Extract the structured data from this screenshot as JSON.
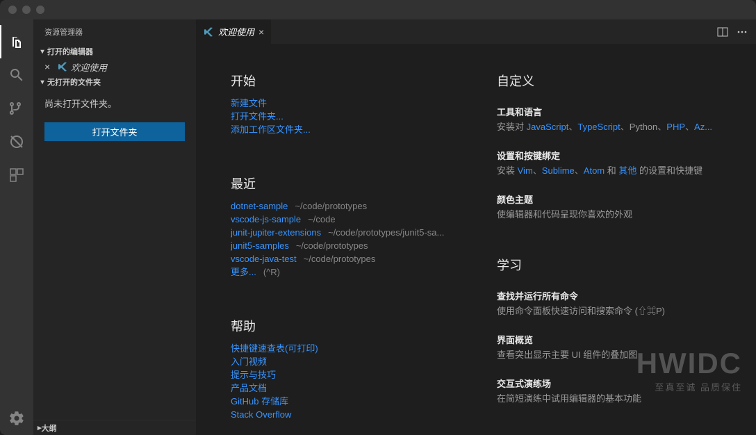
{
  "sidebar": {
    "title": "资源管理器",
    "openEditorsLabel": "打开的编辑器",
    "noFolderLabel": "无打开的文件夹",
    "noFolderOpenText": "尚未打开文件夹。",
    "openFolderButton": "打开文件夹",
    "outlineLabel": "大纲",
    "openEditors": [
      {
        "label": "欢迎使用"
      }
    ]
  },
  "tab": {
    "label": "欢迎使用"
  },
  "welcome": {
    "start": {
      "heading": "开始",
      "newFile": "新建文件",
      "openFolder": "打开文件夹...",
      "addWorkspace": "添加工作区文件夹..."
    },
    "recent": {
      "heading": "最近",
      "items": [
        {
          "name": "dotnet-sample",
          "path": "~/code/prototypes"
        },
        {
          "name": "vscode-js-sample",
          "path": "~/code"
        },
        {
          "name": "junit-jupiter-extensions",
          "path": "~/code/prototypes/junit5-sa..."
        },
        {
          "name": "junit5-samples",
          "path": "~/code/prototypes"
        },
        {
          "name": "vscode-java-test",
          "path": "~/code/prototypes"
        }
      ],
      "moreLabel": "更多...",
      "moreShortcut": "(^R)"
    },
    "help": {
      "heading": "帮助",
      "items": [
        "快捷键速查表(可打印)",
        "入门视频",
        "提示与技巧",
        "产品文档",
        "GitHub 存储库",
        "Stack Overflow"
      ]
    },
    "customize": {
      "heading": "自定义",
      "tools": {
        "title": "工具和语言",
        "prefix": "安装对 ",
        "links": [
          "JavaScript",
          "TypeScript",
          "Python",
          "PHP",
          "Az..."
        ],
        "python": "Python"
      },
      "keys": {
        "title": "设置和按键绑定",
        "prefix": "安装 ",
        "links": [
          "Vim",
          "Sublime",
          "Atom"
        ],
        "and": " 和 ",
        "other": "其他",
        "suffix": " 的设置和快捷键"
      },
      "theme": {
        "title": "颜色主题",
        "desc": "使编辑器和代码呈现你喜欢的外观"
      }
    },
    "learn": {
      "heading": "学习",
      "cmd": {
        "title": "查找并运行所有命令",
        "desc": "使用命令面板快速访问和搜索命令 (⇧⌘P)"
      },
      "ui": {
        "title": "界面概览",
        "desc": "查看突出显示主要 UI 组件的叠加图"
      },
      "play": {
        "title": "交互式演练场",
        "desc": "在简短演练中试用编辑器的基本功能"
      }
    }
  },
  "watermark": {
    "big": "HWIDC",
    "small": "至真至诚 品质保住"
  }
}
